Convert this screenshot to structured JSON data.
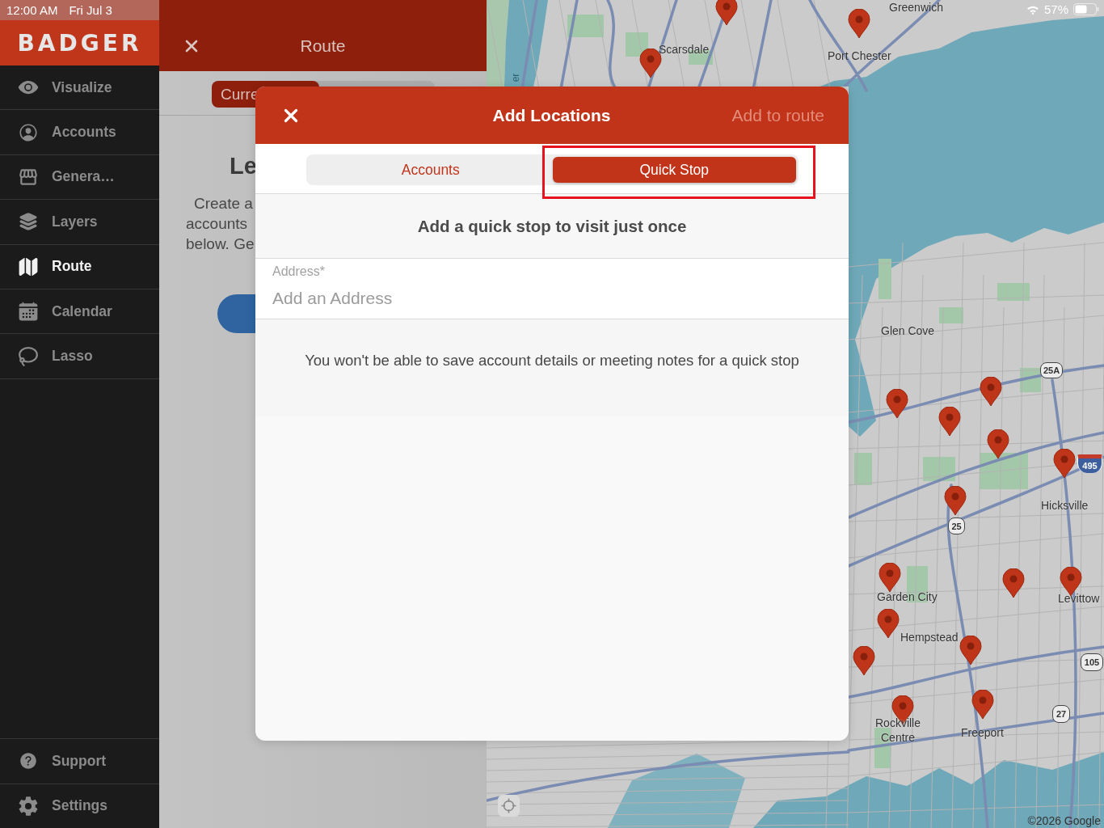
{
  "status_bar": {
    "time": "12:00 AM",
    "date": "Fri Jul 3",
    "battery": "57%"
  },
  "sidebar": {
    "logo": "BADGER",
    "items": [
      {
        "label": "Visualize",
        "selected": false
      },
      {
        "label": "Accounts",
        "selected": false
      },
      {
        "label": "Genera…",
        "selected": false
      },
      {
        "label": "Layers",
        "selected": false
      },
      {
        "label": "Route",
        "selected": true
      },
      {
        "label": "Calendar",
        "selected": false
      },
      {
        "label": "Lasso",
        "selected": false
      }
    ],
    "footer_items": [
      {
        "label": "Support",
        "selected": false
      },
      {
        "label": "Settings",
        "selected": false
      }
    ]
  },
  "route_panel": {
    "title": "Route",
    "segments": [
      {
        "label": "Curre",
        "selected": true
      }
    ],
    "heading": "Le",
    "text_lines": [
      "Create a",
      "accounts",
      "below. Ge"
    ]
  },
  "map": {
    "labels": [
      "Greenwich",
      "Scarsdale",
      "Port Chester",
      "Glen Cove",
      "Hicksville",
      "Garden City",
      "Levittow",
      "Hempstead",
      "Rockville Centre",
      "Freeport"
    ],
    "river_label": "er",
    "shields": [
      {
        "label": "25A",
        "kind": "state"
      },
      {
        "label": "495",
        "kind": "interstate"
      },
      {
        "label": "25",
        "kind": "state"
      },
      {
        "label": "105",
        "kind": "state"
      },
      {
        "label": "27",
        "kind": "state"
      }
    ],
    "attribution": "©2026 Google"
  },
  "modal": {
    "title": "Add Locations",
    "action": {
      "label": "Add to route",
      "disabled": true
    },
    "tabs": [
      {
        "label": "Accounts",
        "selected": false,
        "highlighted": false
      },
      {
        "label": "Quick Stop",
        "selected": true,
        "highlighted": true
      }
    ],
    "subtitle": "Add a quick stop to visit just once",
    "address": {
      "label": "Address*",
      "placeholder": "Add an Address"
    },
    "note": "You won't be able to save account details or meeting notes for a quick stop"
  }
}
